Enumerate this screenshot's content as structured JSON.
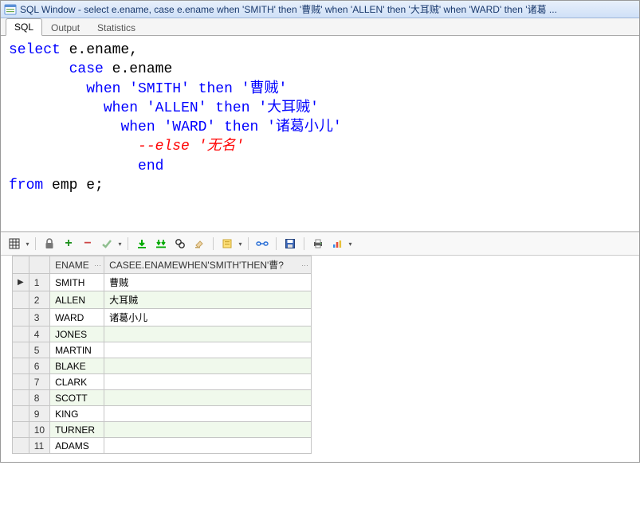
{
  "window": {
    "title": "SQL Window - select e.ename, case e.ename when 'SMITH' then '曹贼' when 'ALLEN' then '大耳贼' when 'WARD' then '诸葛 ..."
  },
  "tabs": [
    {
      "label": "SQL",
      "active": true
    },
    {
      "label": "Output",
      "active": false
    },
    {
      "label": "Statistics",
      "active": false
    }
  ],
  "sql": {
    "l1a": "select",
    "l1b": " e.ename,",
    "l2a": "       ",
    "l2b": "case",
    "l2c": " e.ename",
    "l3a": "         ",
    "l3b": "when",
    "l3c": " ",
    "l3d": "'SMITH'",
    "l3e": " ",
    "l3f": "then",
    "l3g": " ",
    "l3h": "'曹贼'",
    "l4a": "           ",
    "l4b": "when",
    "l4c": " ",
    "l4d": "'ALLEN'",
    "l4e": " ",
    "l4f": "then",
    "l4g": " ",
    "l4h": "'大耳贼'",
    "l5a": "             ",
    "l5b": "when",
    "l5c": " ",
    "l5d": "'WARD'",
    "l5e": " ",
    "l5f": "then",
    "l5g": " ",
    "l5h": "'诸葛小儿'",
    "l6a": "               ",
    "l6b": "--else '无名'",
    "l7a": "               ",
    "l7b": "end",
    "l8a": "from",
    "l8b": " emp e;"
  },
  "grid": {
    "headers": {
      "ename": "ENAME",
      "case": "CASEE.ENAMEWHEN'SMITH'THEN'曹?",
      "dots": "···",
      "dots2": "···"
    },
    "rows": [
      {
        "n": "1",
        "ename": "SMITH",
        "val": "曹贼",
        "mark": "▶"
      },
      {
        "n": "2",
        "ename": "ALLEN",
        "val": "大耳贼",
        "mark": ""
      },
      {
        "n": "3",
        "ename": "WARD",
        "val": "诸葛小儿",
        "mark": ""
      },
      {
        "n": "4",
        "ename": "JONES",
        "val": "",
        "mark": ""
      },
      {
        "n": "5",
        "ename": "MARTIN",
        "val": "",
        "mark": ""
      },
      {
        "n": "6",
        "ename": "BLAKE",
        "val": "",
        "mark": ""
      },
      {
        "n": "7",
        "ename": "CLARK",
        "val": "",
        "mark": ""
      },
      {
        "n": "8",
        "ename": "SCOTT",
        "val": "",
        "mark": ""
      },
      {
        "n": "9",
        "ename": "KING",
        "val": "",
        "mark": ""
      },
      {
        "n": "10",
        "ename": "TURNER",
        "val": "",
        "mark": ""
      },
      {
        "n": "11",
        "ename": "ADAMS",
        "val": "",
        "mark": ""
      }
    ]
  }
}
